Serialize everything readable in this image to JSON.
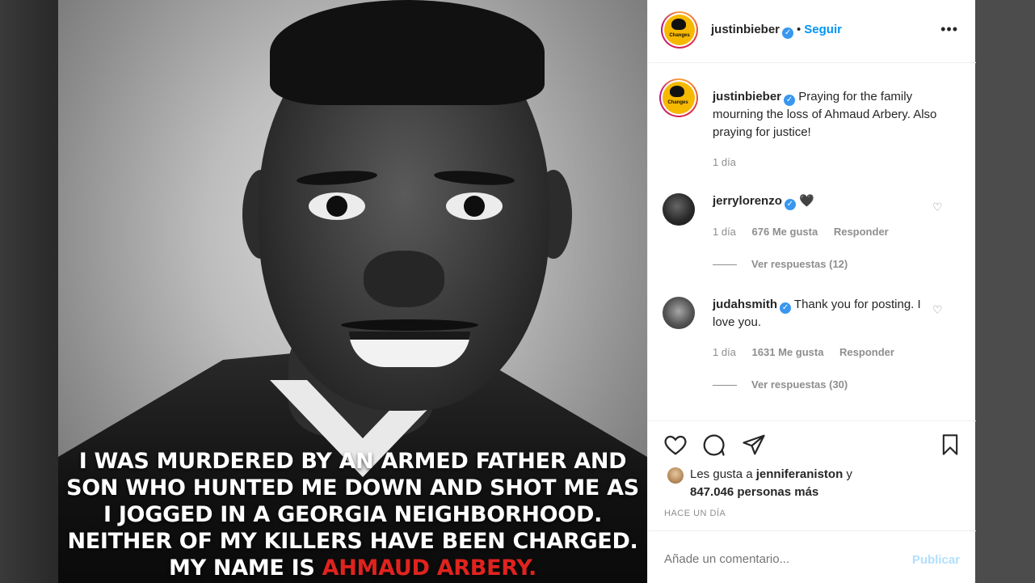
{
  "post": {
    "caption_lines": [
      "I WAS MURDERED BY AN ARMED FATHER AND",
      "SON WHO HUNTED ME DOWN AND SHOT ME AS",
      "I JOGGED IN A GEORGIA NEIGHBORHOOD.",
      "NEITHER OF MY KILLERS HAVE BEEN CHARGED."
    ],
    "caption_last_prefix": "MY NAME IS ",
    "caption_last_highlight": "AHMAUD ARBERY."
  },
  "header": {
    "username": "justinbieber",
    "dot": "•",
    "follow_label": "Seguir",
    "more_label": "•••"
  },
  "caption_entry": {
    "username": "justinbieber",
    "text": "Praying for the family mourning the loss of Ahmaud Arbery. Also praying for justice!",
    "time": "1 día"
  },
  "comments": [
    {
      "username": "jerrylorenzo",
      "text": "🖤",
      "time": "1 día",
      "likes": "676 Me gusta",
      "reply": "Responder",
      "view_replies": "Ver respuestas (12)"
    },
    {
      "username": "judahsmith",
      "text": "Thank you for posting. I love you.",
      "time": "1 día",
      "likes": "1631 Me gusta",
      "reply": "Responder",
      "view_replies": "Ver respuestas (30)"
    }
  ],
  "likes": {
    "prefix": "Les gusta a ",
    "user": "jenniferaniston",
    "middle": " y",
    "count": "847.046 personas más"
  },
  "timestamp": "HACE UN DÍA",
  "add_comment": {
    "placeholder": "Añade un comentario...",
    "publish_label": "Publicar"
  },
  "colors": {
    "accent": "#0095f6",
    "highlight": "#e0231e",
    "verified": "#3897f0"
  }
}
